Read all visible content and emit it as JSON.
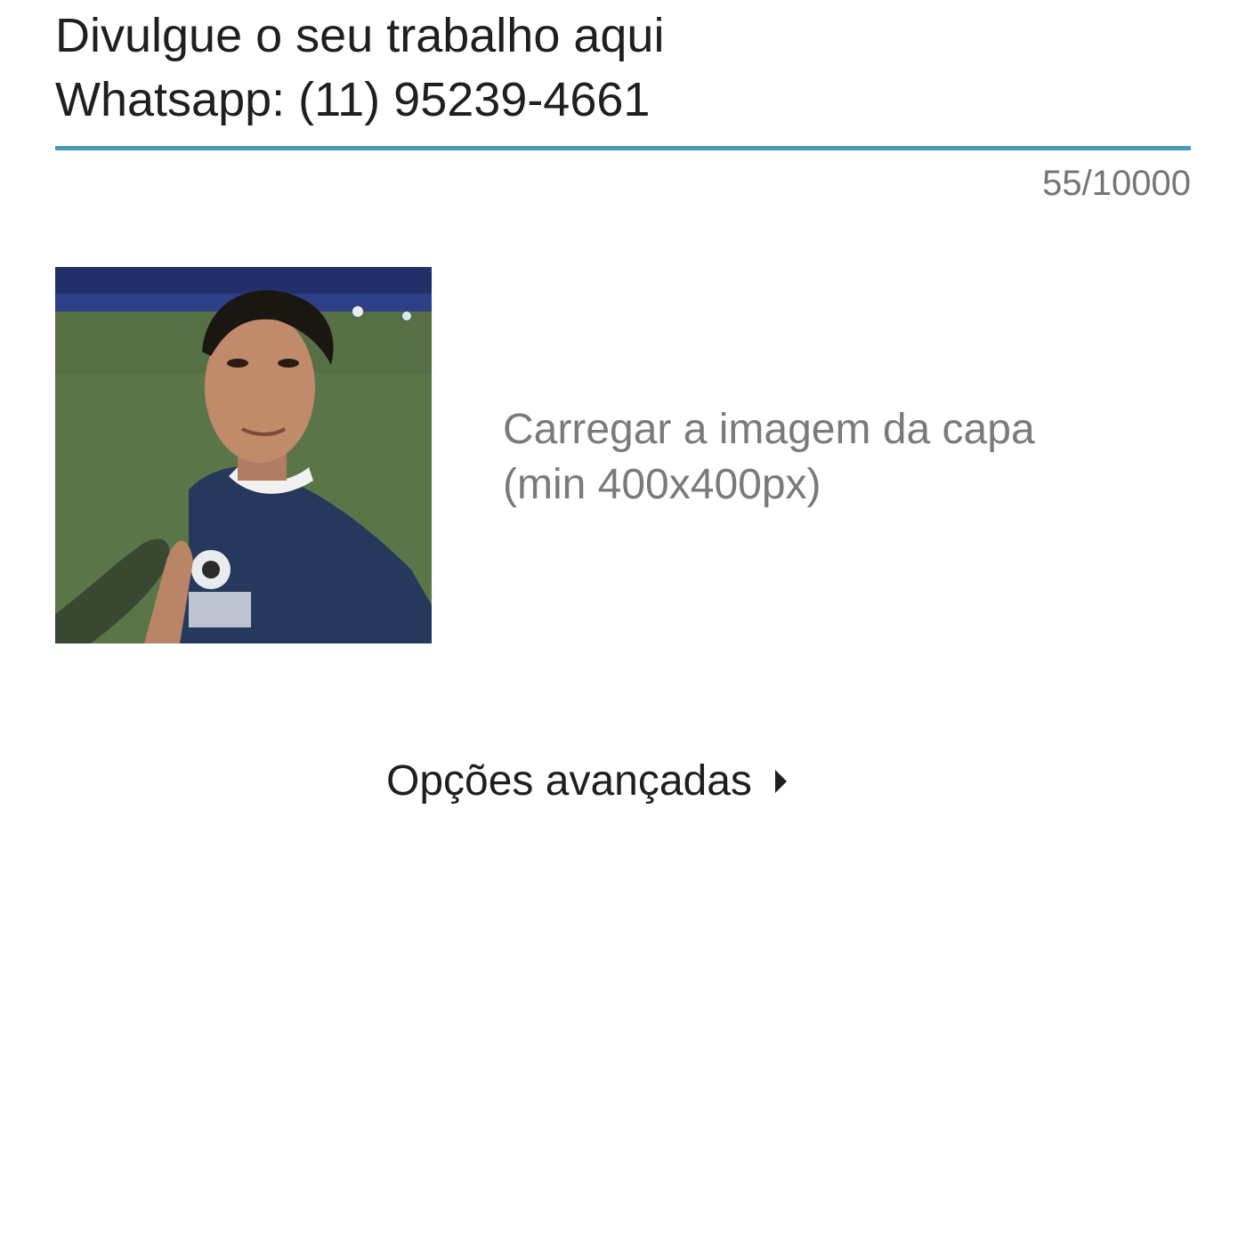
{
  "description": {
    "text": "Divulgue o seu trabalho aqui\nWhatsapp: (11) 95239-4661",
    "counter": "55/10000"
  },
  "cover": {
    "upload_label": "Carregar a imagem da capa\n(min 400x400px)"
  },
  "advanced": {
    "label": "Opções avançadas",
    "icon": "caret-right-icon"
  },
  "colors": {
    "accent_underline": "#4a9ab6",
    "muted_text": "#757575"
  }
}
